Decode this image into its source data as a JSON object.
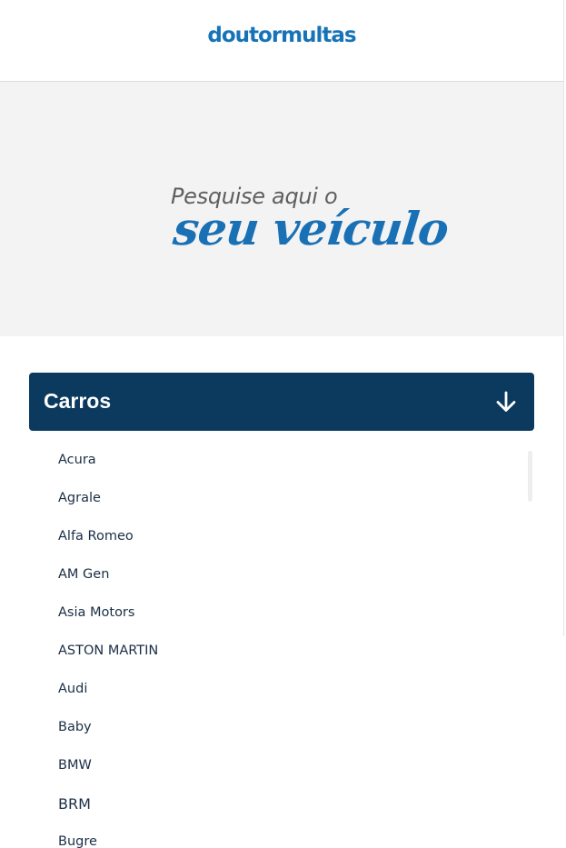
{
  "header": {
    "logo_text": "doutormultas"
  },
  "hero": {
    "line1": "Pesquise aqui o",
    "line2": "seu veículo"
  },
  "category": {
    "title": "Carros",
    "icon": "arrow-down-icon",
    "background_color": "#0c3a5f"
  },
  "brands": [
    "Acura",
    "Agrale",
    "Alfa Romeo",
    "AM Gen",
    "Asia Motors",
    "ASTON MARTIN",
    "Audi",
    "Baby",
    "BMW",
    "BRM",
    "Bugre"
  ],
  "colors": {
    "brand_blue": "#1673b8",
    "hero_bg": "#f3f3f3",
    "category_bar": "#0c3a5f",
    "list_text": "#1b2f45"
  }
}
